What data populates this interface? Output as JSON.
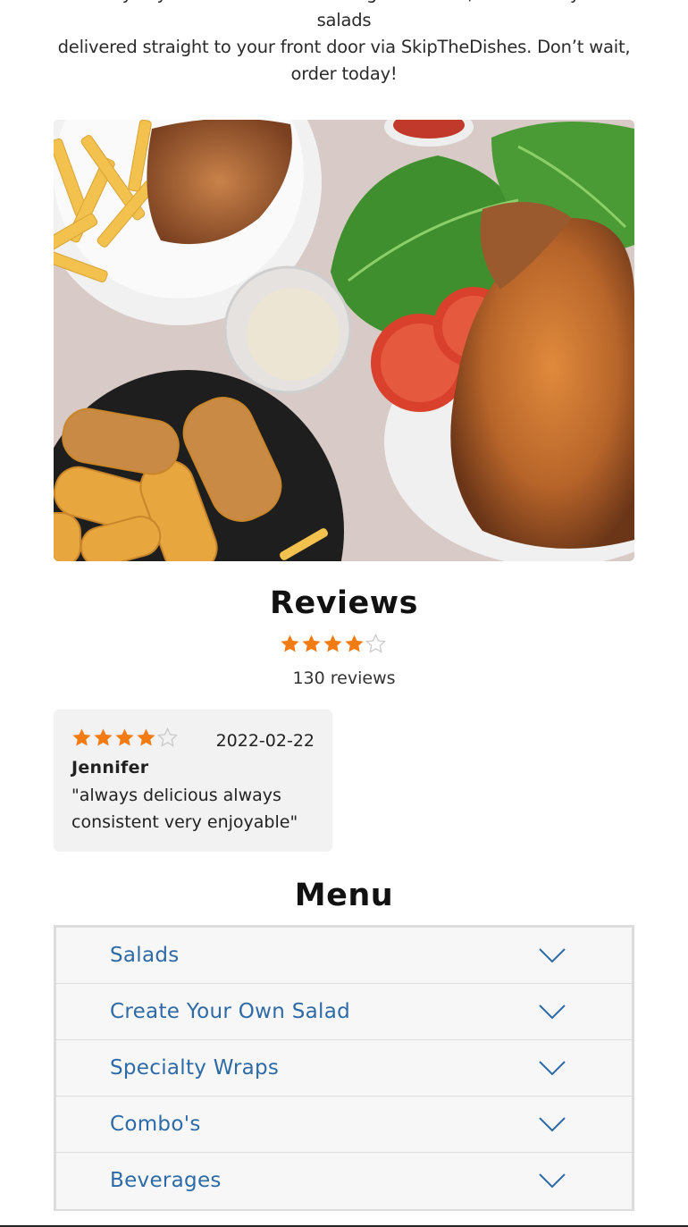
{
  "intro": {
    "lines": [
      "family. If you don’t feel like leaving the house, then have your salads",
      "delivered straight to your front door via SkipTheDishes. Don’t wait,",
      "order today!"
    ]
  },
  "reviews": {
    "title": "Reviews",
    "rating": 4,
    "max_rating": 5,
    "count_label": "130 reviews",
    "items": [
      {
        "rating": 4,
        "date": "2022-02-22",
        "author": "Jennifer",
        "text": "\"always delicious always consistent very enjoyable\""
      }
    ]
  },
  "menu": {
    "title": "Menu",
    "categories": [
      {
        "label": "Salads"
      },
      {
        "label": "Create Your Own Salad"
      },
      {
        "label": "Specialty Wraps"
      },
      {
        "label": "Combo's"
      },
      {
        "label": "Beverages"
      }
    ]
  },
  "colors": {
    "star_filled": "#f47a12",
    "star_empty": "#c8c8c8",
    "menu_link": "#2e6aa6",
    "card_bg": "#f2f2f2"
  }
}
